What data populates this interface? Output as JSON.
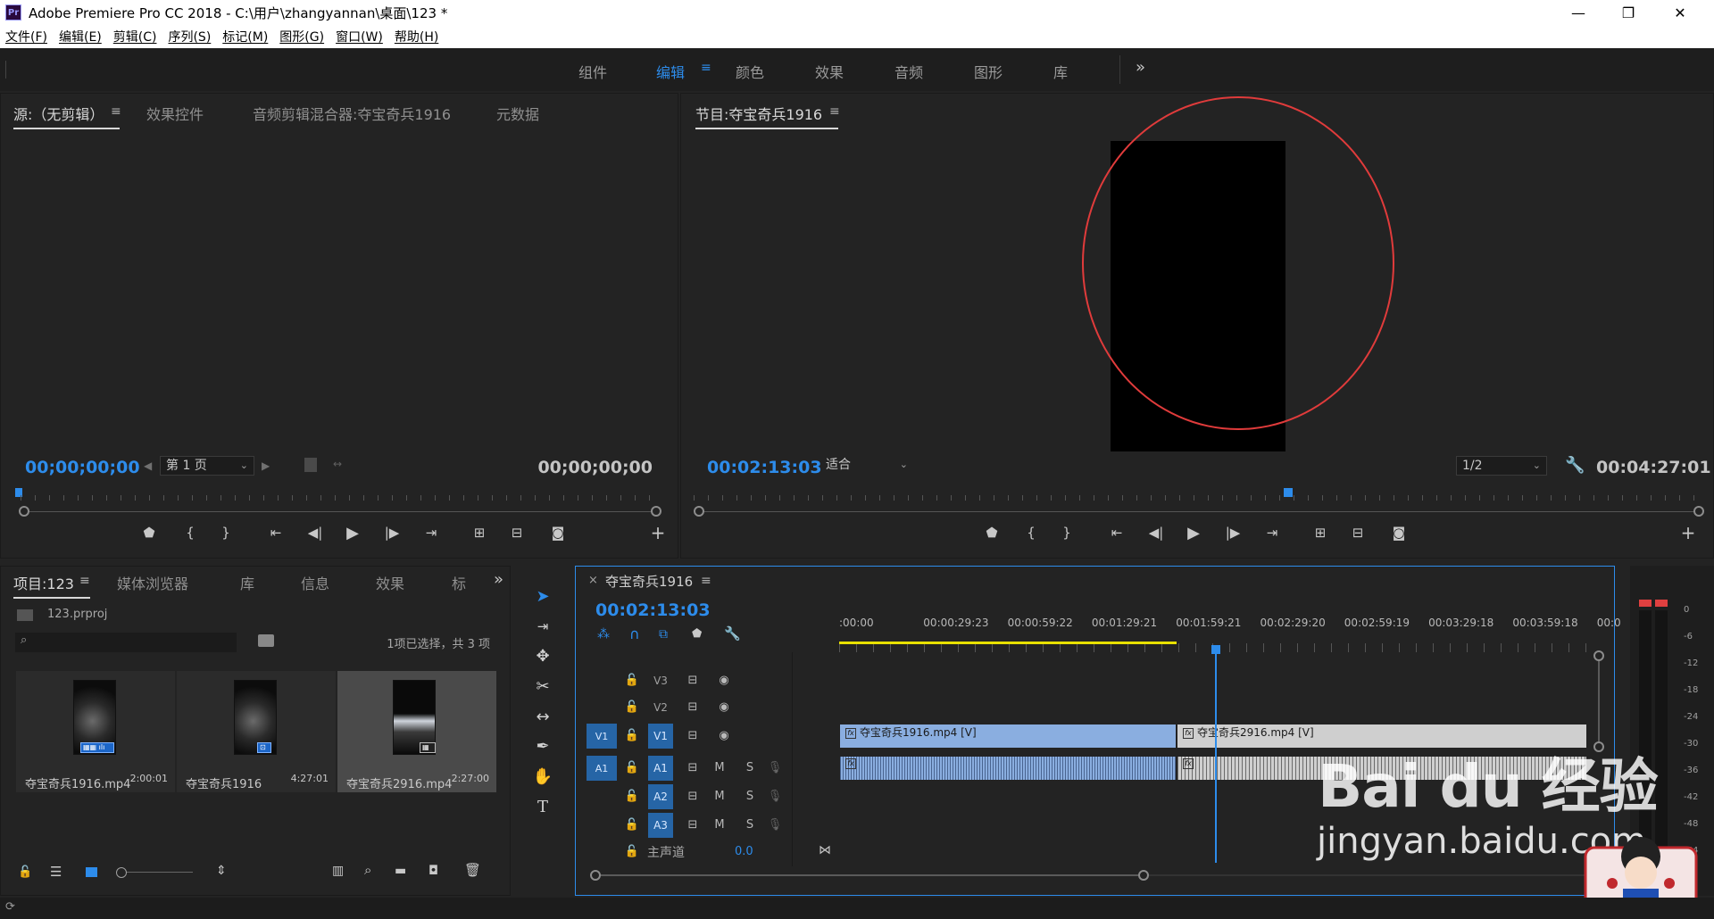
{
  "window": {
    "app_icon": "Pr",
    "title": "Adobe Premiere Pro CC 2018 - C:\\用户\\zhangyannan\\桌面\\123 *",
    "minimize": "—",
    "restore": "❐",
    "close": "✕"
  },
  "menu": [
    "文件(F)",
    "编辑(E)",
    "剪辑(C)",
    "序列(S)",
    "标记(M)",
    "图形(G)",
    "窗口(W)",
    "帮助(H)"
  ],
  "workspaces": {
    "tabs": [
      "组件",
      "编辑",
      "颜色",
      "效果",
      "音频",
      "图形",
      "库"
    ],
    "active": "编辑",
    "more": "»"
  },
  "source_panel": {
    "tabs": [
      "源:（无剪辑）",
      "效果控件",
      "音频剪辑混合器:夺宝奇兵1916",
      "元数据"
    ],
    "timecode_in": "00;00;00;00",
    "page_select": "第 1 页",
    "timecode_out": "00;00;00;00"
  },
  "program_panel": {
    "title": "节目:夺宝奇兵1916",
    "timecode": "00:02:13:03",
    "zoom": "适合",
    "resolution": "1/2",
    "duration": "00:04:27:01",
    "playhead_position": 0.59
  },
  "project_panel": {
    "tabs": [
      "项目:123",
      "媒体浏览器",
      "库",
      "信息",
      "效果",
      "标"
    ],
    "project_file": "123.prproj",
    "search_placeholder": "",
    "selection_status": "1项已选择，共 3 项",
    "items": [
      {
        "name": "夺宝奇兵1916.mp4",
        "duration": "2:00:01",
        "thumb_text": "他们在地球的尽头\n发现了最古老的宝藏"
      },
      {
        "name": "夺宝奇兵1916",
        "duration": "4:27:01",
        "thumb_text": "他们在地球的尽头\n发现了最古老的宝藏"
      },
      {
        "name": "夺宝奇兵2916.mp4",
        "duration": "2:27:00",
        "thumb_text": "他们在地球的尽头\n发现了最古老的宝藏"
      }
    ]
  },
  "timeline": {
    "sequence_name": "夺宝奇兵1916",
    "timecode": "00:02:13:03",
    "ruler": [
      ":00:00",
      "00:00:29:23",
      "00:00:59:22",
      "00:01:29:21",
      "00:01:59:21",
      "00:02:29:20",
      "00:02:59:19",
      "00:03:29:18",
      "00:03:59:18",
      "00:0"
    ],
    "video_tracks": [
      "V3",
      "V2",
      "V1"
    ],
    "audio_tracks": [
      "A1",
      "A2",
      "A3"
    ],
    "source_patch_v": "V1",
    "source_patch_a": "A1",
    "mute_label": "M",
    "solo_label": "S",
    "master": {
      "label": "主声道",
      "value": "0.0"
    },
    "clips": [
      {
        "name": "夺宝奇兵1916.mp4 [V]",
        "track": "V1"
      },
      {
        "name": "夺宝奇兵2916.mp4 [V]",
        "track": "V1"
      }
    ]
  },
  "meter": {
    "db_labels": [
      "0",
      "-6",
      "-12",
      "-18",
      "-24",
      "-30",
      "-36",
      "-42",
      "-48",
      "-54"
    ]
  },
  "watermark": {
    "brand": "Bai du 经验",
    "url": "jingyan.baidu.com"
  },
  "colors": {
    "accent_blue": "#2d8ceb",
    "clip_blue": "#8aaee0",
    "marker_red": "#e03b3b",
    "work_area_yellow": "#e8e000"
  }
}
